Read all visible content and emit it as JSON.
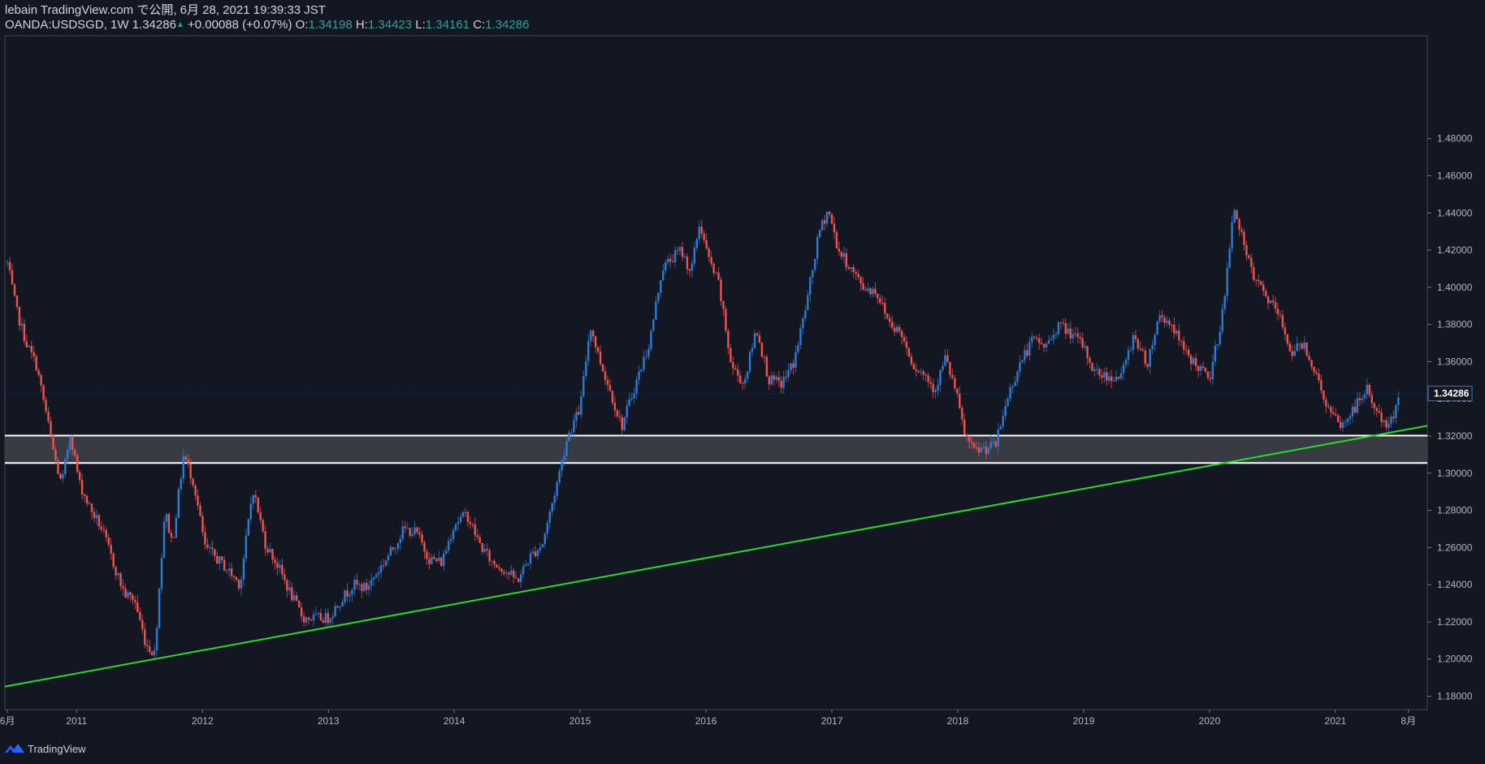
{
  "header": {
    "publish_line": "lebain TradingView.com で公開, 6月 28, 2021 19:39:33 JST",
    "symbol": "OANDA:USDSGD, 1W",
    "last": "1.34286",
    "change": "+0.00088 (+0.07%)",
    "open_label": "O:",
    "open": "1.34198",
    "high_label": "H:",
    "high": "1.34423",
    "low_label": "L:",
    "low": "1.34161",
    "close_label": "C:",
    "close": "1.34286"
  },
  "footer": {
    "brand": "TradingView"
  },
  "colors": {
    "background": "#131722",
    "up": "#2e7bd6",
    "down": "#ef5350",
    "support_line": "#ffffff",
    "zone_fill": "#3a3d47",
    "trendline": "#22e022",
    "price_badge": "#131722"
  },
  "chart_data": {
    "type": "candlestick",
    "interval": "1W",
    "ylim": [
      1.17,
      1.49
    ],
    "y_ticks": [
      "1.48000",
      "1.46000",
      "1.44000",
      "1.42000",
      "1.40000",
      "1.38000",
      "1.36000",
      "1.34000",
      "1.32000",
      "1.30000",
      "1.28000",
      "1.26000",
      "1.24000",
      "1.22000",
      "1.20000",
      "1.18000"
    ],
    "x_ticks": [
      {
        "label": "6月",
        "t": 2010.45
      },
      {
        "label": "2011",
        "t": 2011.0
      },
      {
        "label": "2012",
        "t": 2012.0
      },
      {
        "label": "2013",
        "t": 2013.0
      },
      {
        "label": "2014",
        "t": 2014.0
      },
      {
        "label": "2015",
        "t": 2015.0
      },
      {
        "label": "2016",
        "t": 2016.0
      },
      {
        "label": "2017",
        "t": 2017.0
      },
      {
        "label": "2018",
        "t": 2018.0
      },
      {
        "label": "2019",
        "t": 2019.0
      },
      {
        "label": "2020",
        "t": 2020.0
      },
      {
        "label": "2021",
        "t": 2021.0
      },
      {
        "label": "8月",
        "t": 2021.58
      }
    ],
    "xlim": [
      2010.43,
      2021.73
    ],
    "current_price_label": "1.34286",
    "current_price": 1.34286,
    "zone": {
      "top": 1.3202,
      "bottom": 1.3055
    },
    "trendline": {
      "t1": 2010.43,
      "p1": 1.1852,
      "t2": 2021.73,
      "p2": 1.3255
    },
    "path": [
      [
        2010.45,
        1.413
      ],
      [
        2010.52,
        1.388
      ],
      [
        2010.6,
        1.37
      ],
      [
        2010.68,
        1.358
      ],
      [
        2010.75,
        1.335
      ],
      [
        2010.82,
        1.31
      ],
      [
        2010.88,
        1.293
      ],
      [
        2010.95,
        1.322
      ],
      [
        2011.02,
        1.295
      ],
      [
        2011.1,
        1.282
      ],
      [
        2011.2,
        1.27
      ],
      [
        2011.3,
        1.25
      ],
      [
        2011.38,
        1.235
      ],
      [
        2011.46,
        1.232
      ],
      [
        2011.55,
        1.208
      ],
      [
        2011.62,
        1.203
      ],
      [
        2011.7,
        1.28
      ],
      [
        2011.76,
        1.262
      ],
      [
        2011.85,
        1.31
      ],
      [
        2011.93,
        1.295
      ],
      [
        2012.02,
        1.26
      ],
      [
        2012.1,
        1.255
      ],
      [
        2012.2,
        1.248
      ],
      [
        2012.3,
        1.24
      ],
      [
        2012.4,
        1.292
      ],
      [
        2012.5,
        1.262
      ],
      [
        2012.6,
        1.25
      ],
      [
        2012.7,
        1.235
      ],
      [
        2012.8,
        1.222
      ],
      [
        2012.9,
        1.222
      ],
      [
        2013.0,
        1.222
      ],
      [
        2013.1,
        1.232
      ],
      [
        2013.2,
        1.24
      ],
      [
        2013.3,
        1.238
      ],
      [
        2013.4,
        1.248
      ],
      [
        2013.5,
        1.258
      ],
      [
        2013.6,
        1.27
      ],
      [
        2013.7,
        1.268
      ],
      [
        2013.8,
        1.254
      ],
      [
        2013.9,
        1.252
      ],
      [
        2014.0,
        1.273
      ],
      [
        2014.1,
        1.278
      ],
      [
        2014.2,
        1.262
      ],
      [
        2014.3,
        1.252
      ],
      [
        2014.4,
        1.248
      ],
      [
        2014.5,
        1.242
      ],
      [
        2014.6,
        1.255
      ],
      [
        2014.7,
        1.262
      ],
      [
        2014.8,
        1.29
      ],
      [
        2014.9,
        1.32
      ],
      [
        2015.0,
        1.335
      ],
      [
        2015.08,
        1.38
      ],
      [
        2015.15,
        1.362
      ],
      [
        2015.25,
        1.342
      ],
      [
        2015.33,
        1.325
      ],
      [
        2015.45,
        1.35
      ],
      [
        2015.55,
        1.37
      ],
      [
        2015.65,
        1.41
      ],
      [
        2015.72,
        1.415
      ],
      [
        2015.8,
        1.42
      ],
      [
        2015.88,
        1.408
      ],
      [
        2015.95,
        1.435
      ],
      [
        2016.02,
        1.415
      ],
      [
        2016.1,
        1.402
      ],
      [
        2016.2,
        1.358
      ],
      [
        2016.3,
        1.348
      ],
      [
        2016.4,
        1.378
      ],
      [
        2016.5,
        1.35
      ],
      [
        2016.6,
        1.348
      ],
      [
        2016.7,
        1.36
      ],
      [
        2016.8,
        1.392
      ],
      [
        2016.9,
        1.43
      ],
      [
        2016.97,
        1.442
      ],
      [
        2017.05,
        1.42
      ],
      [
        2017.15,
        1.41
      ],
      [
        2017.25,
        1.4
      ],
      [
        2017.35,
        1.398
      ],
      [
        2017.45,
        1.382
      ],
      [
        2017.55,
        1.375
      ],
      [
        2017.65,
        1.358
      ],
      [
        2017.75,
        1.352
      ],
      [
        2017.82,
        1.345
      ],
      [
        2017.9,
        1.362
      ],
      [
        2017.98,
        1.345
      ],
      [
        2018.05,
        1.322
      ],
      [
        2018.12,
        1.312
      ],
      [
        2018.2,
        1.313
      ],
      [
        2018.3,
        1.315
      ],
      [
        2018.4,
        1.342
      ],
      [
        2018.5,
        1.36
      ],
      [
        2018.6,
        1.372
      ],
      [
        2018.7,
        1.368
      ],
      [
        2018.8,
        1.38
      ],
      [
        2018.9,
        1.375
      ],
      [
        2019.0,
        1.368
      ],
      [
        2019.08,
        1.355
      ],
      [
        2019.18,
        1.352
      ],
      [
        2019.3,
        1.352
      ],
      [
        2019.4,
        1.375
      ],
      [
        2019.5,
        1.358
      ],
      [
        2019.6,
        1.385
      ],
      [
        2019.7,
        1.38
      ],
      [
        2019.8,
        1.365
      ],
      [
        2019.9,
        1.358
      ],
      [
        2020.0,
        1.35
      ],
      [
        2020.1,
        1.385
      ],
      [
        2020.2,
        1.445
      ],
      [
        2020.27,
        1.422
      ],
      [
        2020.35,
        1.405
      ],
      [
        2020.45,
        1.395
      ],
      [
        2020.55,
        1.385
      ],
      [
        2020.65,
        1.365
      ],
      [
        2020.75,
        1.37
      ],
      [
        2020.85,
        1.352
      ],
      [
        2020.95,
        1.333
      ],
      [
        2021.05,
        1.325
      ],
      [
        2021.15,
        1.335
      ],
      [
        2021.25,
        1.345
      ],
      [
        2021.35,
        1.33
      ],
      [
        2021.43,
        1.324
      ],
      [
        2021.5,
        1.343
      ]
    ]
  }
}
